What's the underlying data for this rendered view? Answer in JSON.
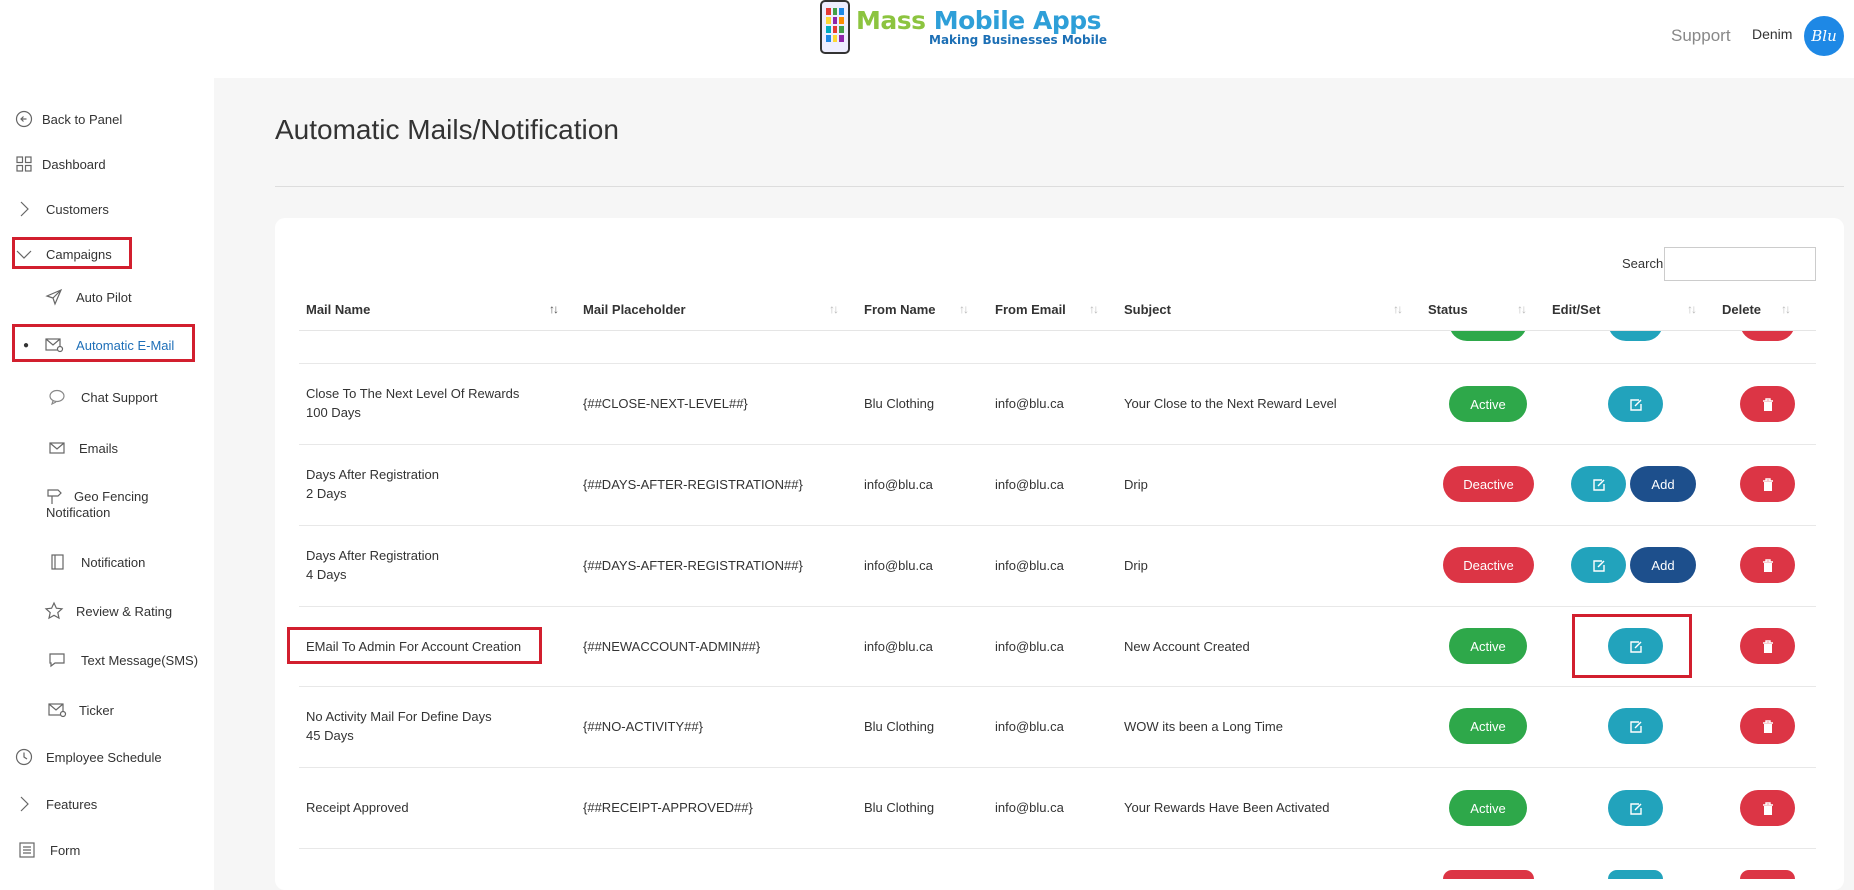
{
  "header": {
    "logo_title_a": "Mass ",
    "logo_title_b": "Mobile Apps",
    "logo_subtitle": "Making  Businesses Mobile",
    "support_label": "Support",
    "user_name": "Denim",
    "avatar_text": "Blu"
  },
  "sidebar": {
    "back": "Back to Panel",
    "dashboard": "Dashboard",
    "customers": "Customers",
    "campaigns": "Campaigns",
    "auto_pilot": "Auto Pilot",
    "automatic_email": "Automatic E-Mail",
    "chat_support": "Chat Support",
    "emails": "Emails",
    "geo_fencing_1": "Geo Fencing",
    "geo_fencing_2": "Notification",
    "notification": "Notification",
    "review_rating": "Review & Rating",
    "text_message": "Text Message(SMS)",
    "ticker": "Ticker",
    "employee_schedule": "Employee Schedule",
    "features": "Features",
    "form": "Form"
  },
  "main": {
    "title": "Automatic Mails/Notification",
    "search_label": "Search:",
    "search_value": ""
  },
  "table": {
    "columns": [
      "Mail Name",
      "Mail Placeholder",
      "From Name",
      "From Email",
      "Subject",
      "Status",
      "Edit/Set",
      "Delete"
    ],
    "edit_icon": "edit-icon",
    "delete_icon": "trash-icon",
    "add_label": "Add",
    "rows": [
      {
        "name_1": "Close To The Next Level Of Rewards",
        "name_2": "100 Days",
        "placeholder": "{##CLOSE-NEXT-LEVEL##}",
        "from_name": "Blu Clothing",
        "from_email": "info@blu.ca",
        "subject": "Your Close to the Next Reward Level",
        "status": "Active"
      },
      {
        "name_1": "Days After Registration",
        "name_2": "2 Days",
        "placeholder": "{##DAYS-AFTER-REGISTRATION##}",
        "from_name": "info@blu.ca",
        "from_email": "info@blu.ca",
        "subject": "Drip",
        "status": "Deactive"
      },
      {
        "name_1": "Days After Registration",
        "name_2": "4 Days",
        "placeholder": "{##DAYS-AFTER-REGISTRATION##}",
        "from_name": "info@blu.ca",
        "from_email": "info@blu.ca",
        "subject": "Drip",
        "status": "Deactive"
      },
      {
        "name_1": "EMail To Admin For Account Creation",
        "name_2": "",
        "placeholder": "{##NEWACCOUNT-ADMIN##}",
        "from_name": "info@blu.ca",
        "from_email": "info@blu.ca",
        "subject": "New Account Created",
        "status": "Active"
      },
      {
        "name_1": "No Activity Mail For Define Days",
        "name_2": "45 Days",
        "placeholder": "{##NO-ACTIVITY##}",
        "from_name": "Blu Clothing",
        "from_email": "info@blu.ca",
        "subject": "WOW its been a Long Time",
        "status": "Active"
      },
      {
        "name_1": "Receipt Approved",
        "name_2": "",
        "placeholder": "{##RECEIPT-APPROVED##}",
        "from_name": "Blu Clothing",
        "from_email": "info@blu.ca",
        "subject": "Your Rewards Have Been Activated",
        "status": "Active"
      }
    ]
  },
  "colors": {
    "active": "#2ea84a",
    "deactive": "#dc3545",
    "edit": "#22a3bc",
    "add": "#1d4f8c",
    "highlight": "#d21f2e"
  }
}
